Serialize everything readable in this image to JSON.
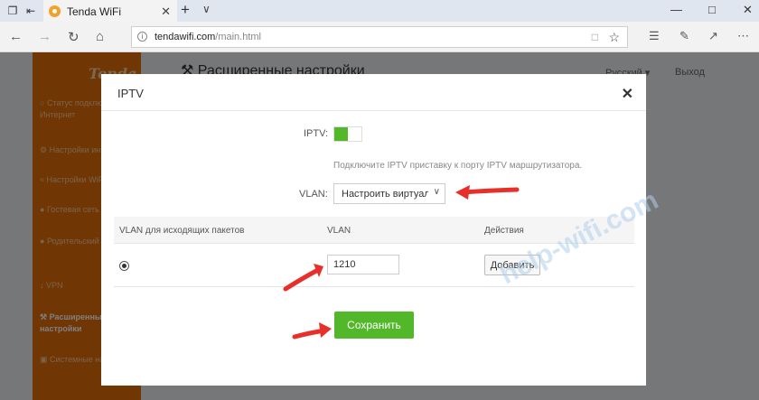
{
  "browser": {
    "tab_title": "Tenda WiFi",
    "url_host": "tendawifi.com",
    "url_path": "/main.html",
    "icons": [
      "tab-manager-icon",
      "back-tab-icon",
      "tenda-favicon",
      "close-icon",
      "plus-icon",
      "chevron-down-icon",
      "minimize-icon",
      "maximize-icon",
      "close-window-icon",
      "back-icon",
      "forward-icon",
      "refresh-icon",
      "home-icon",
      "info-icon",
      "reading-view-icon",
      "favorite-star-icon",
      "hub-icon",
      "pen-icon",
      "share-icon",
      "more-icon"
    ]
  },
  "page": {
    "logo": "Tenda",
    "title": "Расширенные настройки",
    "language": "Русский",
    "logout": "Выход",
    "sidebar": [
      {
        "icon": "globe-icon",
        "label": "Статус подключения к Интернет"
      },
      {
        "icon": "gear-icon",
        "label": "Настройки интернета"
      },
      {
        "icon": "wifi-icon",
        "label": "Настройки WiFi"
      },
      {
        "icon": "guest-icon",
        "label": "Гостевая сеть"
      },
      {
        "icon": "parental-icon",
        "label": "Родительский контроль"
      },
      {
        "icon": "vpn-icon",
        "label": "VPN"
      },
      {
        "icon": "settings-icon",
        "label": "Расширенные настройки"
      },
      {
        "icon": "system-icon",
        "label": "Системные настройки"
      }
    ]
  },
  "modal": {
    "title": "IPTV",
    "iptv_label": "IPTV:",
    "iptv_enabled": true,
    "hint": "Подключите IPTV приставку к порту IPTV маршрутизатора.",
    "vlan_label": "VLAN:",
    "vlan_select_value": "Настроить виртуальную",
    "table": {
      "headers": [
        "VLAN для исходящих пакетов",
        "VLAN",
        "Действия"
      ],
      "vlan_value": "1210",
      "radio_selected": true,
      "add_label": "Добавить"
    },
    "save_label": "Сохранить"
  },
  "watermark": "help-wifi.com",
  "colors": {
    "sidebar": "#e06d07",
    "accent_green": "#52b82a",
    "arrow_red": "#e8302a"
  }
}
